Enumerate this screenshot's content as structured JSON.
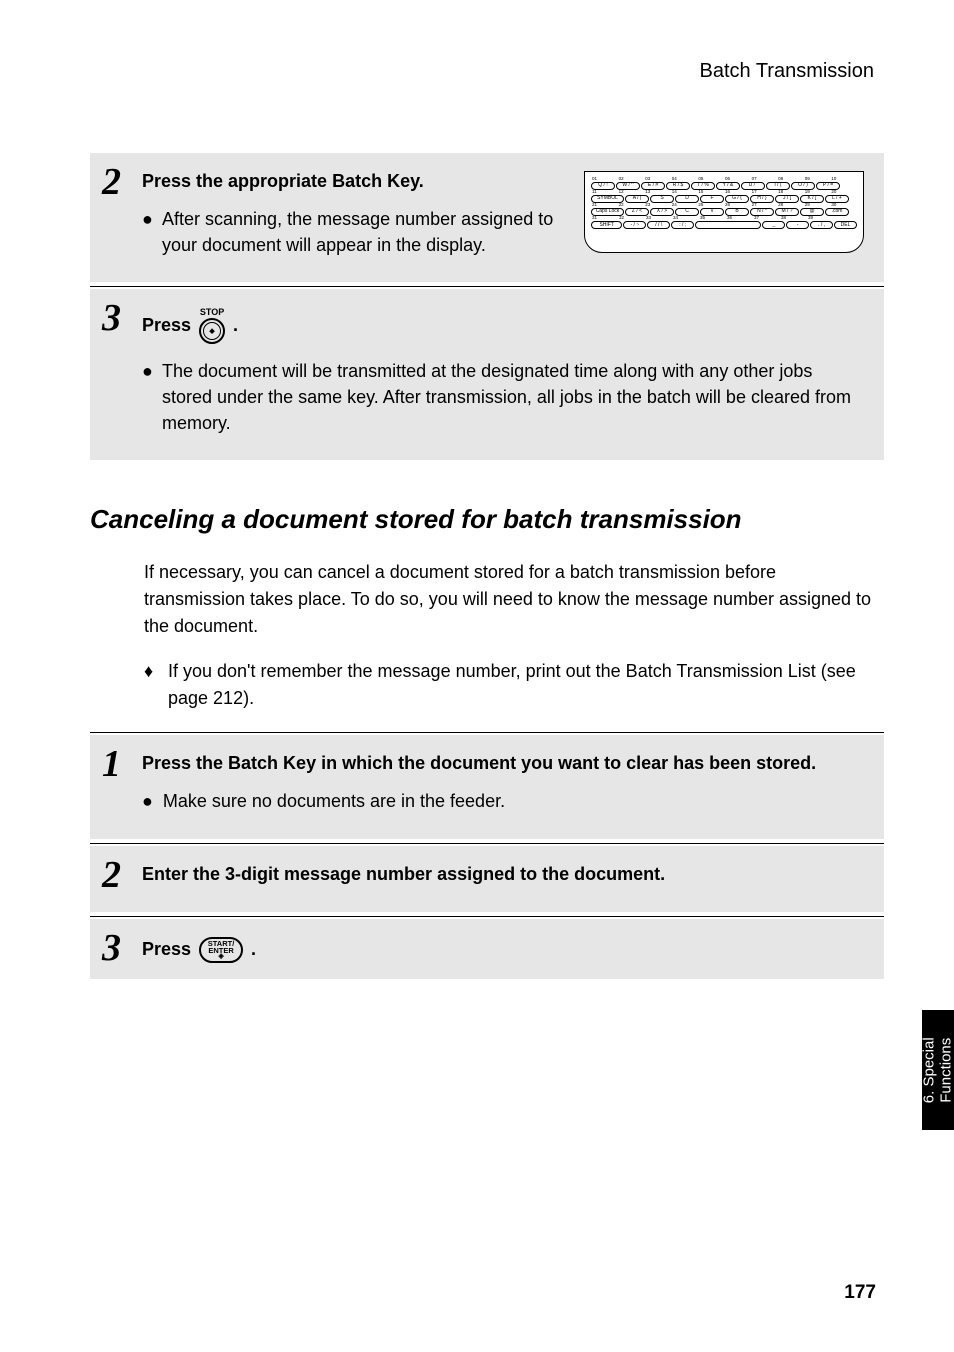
{
  "header": "Batch Transmission",
  "step2": {
    "title": "Press the appropriate Batch Key.",
    "bullet": "After scanning, the message number assigned to your document will appear in the display."
  },
  "keyboard": {
    "numrow1": [
      "01",
      "02",
      "03",
      "04",
      "05",
      "06",
      "07",
      "08",
      "09",
      "10"
    ],
    "row1": [
      "Q / !",
      "W / ^",
      "E / #",
      "R / $",
      "T / %",
      "Y / &",
      "U / '",
      "I / (",
      "O / )",
      "P / ="
    ],
    "numrow2": [
      "11",
      "12",
      "13",
      "14",
      "15",
      "16",
      "17",
      "18",
      "19",
      "20"
    ],
    "row2": [
      "SYMBOL",
      "A / |",
      "S",
      "D",
      "F",
      "G / {",
      "H / }",
      "J / [",
      "K / ]",
      "L / +"
    ],
    "numrow3": [
      "21",
      "22",
      "23",
      "24",
      "25",
      "26",
      "27",
      "28",
      "29",
      "30"
    ],
    "row3": [
      "Caps Lock",
      "Z / <",
      "X / >",
      "C",
      "V",
      "B",
      "N / *",
      "M / ?",
      "@",
      ".com"
    ],
    "numrow4": [
      "31",
      "32",
      "33",
      "34",
      "35",
      "36",
      "37",
      "38",
      "39"
    ],
    "row4": [
      "SHIFT",
      "- / ~",
      "/ / \\",
      ": / ;",
      "",
      "_",
      "-",
      ". / ,",
      "DEL"
    ]
  },
  "step3top": {
    "press": "Press",
    "stop_label": "STOP",
    "dot": ".",
    "bullet": "The document will be transmitted at the designated time along with any other jobs stored under the same key. After transmission, all jobs in the batch will be cleared from memory."
  },
  "section_title": "Canceling a document stored for batch transmission",
  "para1": "If necessary, you can cancel a document stored for a batch transmission before transmission takes place. To do so, you will need to know the message number assigned to the document.",
  "diamond1": "If you don't remember the message number, print out the Batch Transmission List (see page 212).",
  "step1b": {
    "title": "Press the Batch Key in which the document you want to clear has been stored.",
    "bullet": "Make sure no documents are in the feeder."
  },
  "step2b": {
    "title": "Enter the 3-digit message number assigned to the document."
  },
  "step3b": {
    "press": "Press",
    "start1": "START/",
    "start2": "ENTER",
    "dot": "."
  },
  "side_tab": "6. Special\nFunctions",
  "page_number": "177"
}
